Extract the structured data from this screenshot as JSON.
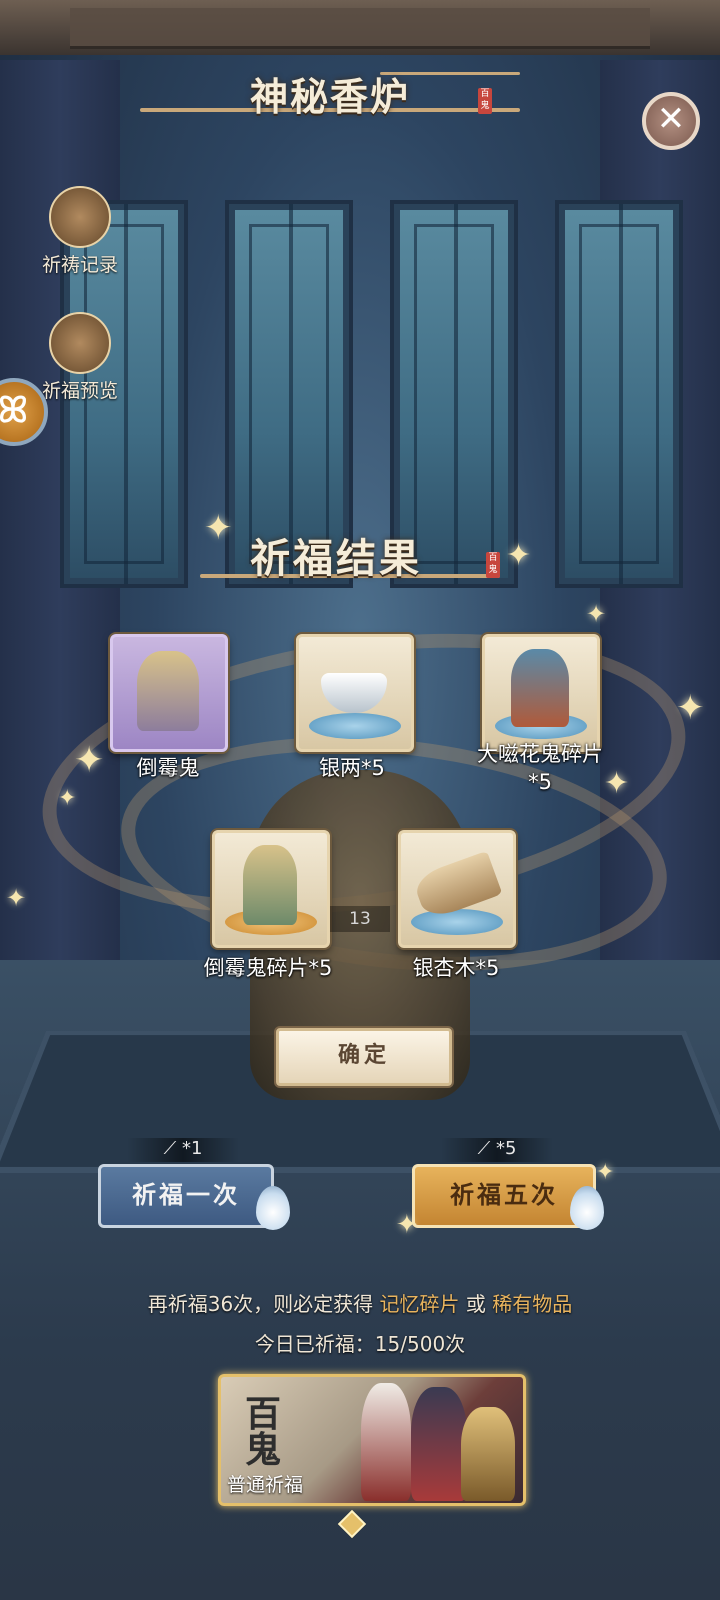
{
  "header": {
    "title": "神秘香炉",
    "seal": "百鬼"
  },
  "side_buttons": {
    "record_label": "祈祷记录",
    "preview_label": "祈福预览"
  },
  "results": {
    "title": "祈福结果",
    "seal": "百鬼",
    "items": [
      {
        "label": "倒霉鬼"
      },
      {
        "label": "银两*5"
      },
      {
        "label": "大嗞花鬼碎片\n*5"
      },
      {
        "label": "倒霉鬼碎片*5"
      },
      {
        "label": "银杏木*5"
      }
    ],
    "counter": "13",
    "confirm_label": "确定"
  },
  "pray": {
    "once_label": "祈福一次",
    "once_cost": "*1",
    "five_label": "祈福五次",
    "five_cost": "*5"
  },
  "info": {
    "line1_prefix": "再祈福36次，则必定获得",
    "line1_item1": "记忆碎片",
    "line1_or": "或",
    "line1_item2": "稀有物品",
    "line2": "今日已祈福：15/500次"
  },
  "banner": {
    "big_text": "百鬼",
    "label": "普通祈福"
  },
  "colors": {
    "accent_gold": "#e9b45e",
    "button_blue": "#4a6a92",
    "button_gold": "#d89c45"
  },
  "icons": [
    "close-icon",
    "scroll-icon",
    "incense-icon",
    "sparkle-icon",
    "incense-stick-icon",
    "flame-icon"
  ]
}
